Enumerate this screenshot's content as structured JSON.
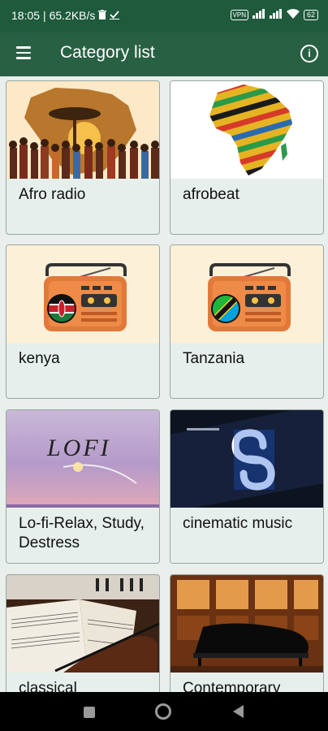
{
  "status": {
    "time": "18:05",
    "speed": "| 65.2KB/s",
    "vpn": "VPN",
    "battery": "62"
  },
  "appbar": {
    "title": "Category list"
  },
  "categories": [
    {
      "label": "Afro radio",
      "image": "africa-people-sunset"
    },
    {
      "label": "afrobeat",
      "image": "colorful-africa-map"
    },
    {
      "label": "kenya",
      "image": "radio-kenya-flag"
    },
    {
      "label": "Tanzania",
      "image": "radio-tanzania-flag"
    },
    {
      "label": "Lo-fi-Relax, Study, Destress",
      "image": "lofi-sunset"
    },
    {
      "label": "cinematic music",
      "image": "logo-screen"
    },
    {
      "label": "classical",
      "image": "sheet-music-violin"
    },
    {
      "label": "Contemporary",
      "image": "grand-piano"
    }
  ],
  "colors": {
    "status_bar": "#1f5a3c",
    "app_bar": "#286043",
    "background": "#e9efec",
    "card": "#e6efeb"
  }
}
